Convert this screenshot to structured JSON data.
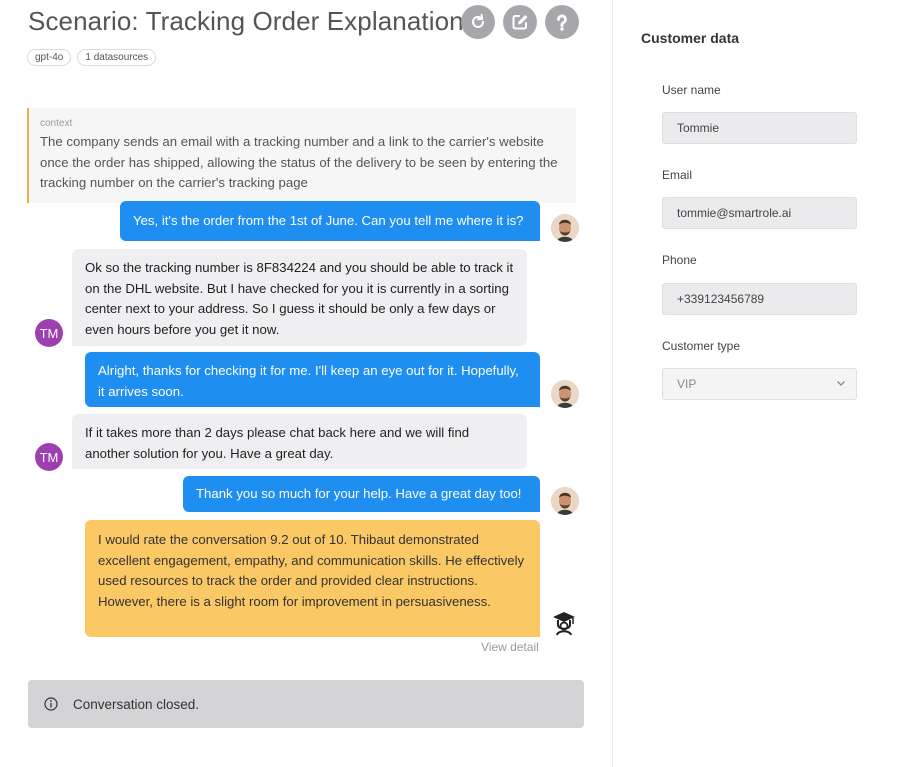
{
  "scenario": {
    "title": "Scenario: Tracking Order Explanation",
    "tags": [
      "gpt-4o",
      "1 datasources"
    ]
  },
  "context": {
    "label": "context",
    "text": "The company sends an email with a tracking number and a link to the carrier's website once the order has shipped, allowing the status of the delivery to be seen by entering the tracking number on the carrier's tracking page"
  },
  "messages": [
    {
      "role": "user",
      "text": "Yes, it's the order from the 1st of June. Can you tell me where it is?"
    },
    {
      "role": "bot",
      "avatar": "TM",
      "text": "Ok so the tracking number is 8F834224 and you should be able to track it on the DHL website. But I have checked for you it is currently in a sorting center next to your address. So I guess it should be only a few days or even hours before you get it now."
    },
    {
      "role": "user",
      "text": "Alright, thanks for checking it for me. I'll keep an eye out for it. Hopefully, it arrives soon."
    },
    {
      "role": "bot",
      "avatar": "TM",
      "text": "If it takes more than 2 days please chat back here and we will find another solution for you. Have a great day."
    },
    {
      "role": "user",
      "text": "Thank you so much for your help. Have a great day too!"
    }
  ],
  "evaluation": {
    "text": "I would rate the conversation 9.2 out of 10. Thibaut demonstrated excellent engagement, empathy, and communication skills. He effectively used resources to track the order and provided clear instructions. However, there is a slight room for improvement in persuasiveness.",
    "link": "View detail"
  },
  "status": {
    "text": "Conversation closed."
  },
  "customer": {
    "title": "Customer data",
    "username_label": "User name",
    "username": "Tommie",
    "email_label": "Email",
    "email": "tommie@smartrole.ai",
    "phone_label": "Phone",
    "phone": "+339123456789",
    "type_label": "Customer type",
    "type": "VIP"
  },
  "colors": {
    "user_bubble": "#1f8ef1",
    "bot_bubble": "#efeff2",
    "eval_bubble": "#fac865",
    "bot_avatar": "#9e3fb1",
    "context_accent": "#e8b34a"
  }
}
